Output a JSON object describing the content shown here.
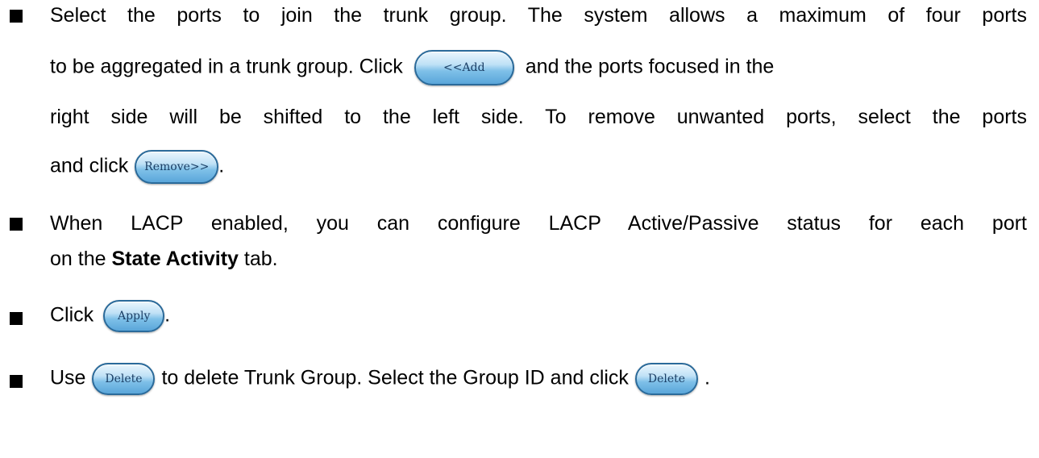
{
  "bullet1": {
    "line1": "Select the ports to join the trunk group. The system allows a maximum of four ports",
    "line2_a": "to be aggregated in a trunk group. Click",
    "add_button": "<<Add",
    "line2_b": "and the ports focused in the",
    "line3": "right side will be shifted to the left side. To remove unwanted ports, select the ports",
    "line4_a": "and click",
    "remove_button": "Remove>>",
    "line4_b": "."
  },
  "bullet2": {
    "line1": "When LACP enabled, you can configure LACP Active/Passive status for each port",
    "line2_a": "on the",
    "line2_bold": "State Activity",
    "line2_b": "tab."
  },
  "bullet3": {
    "text_a": "Click",
    "apply_button": "Apply",
    "text_b": "."
  },
  "bullet4": {
    "text_a": "Use",
    "delete_button_1": "Delete",
    "text_b": "to delete Trunk Group. Select the Group ID and click",
    "delete_button_2": "Delete",
    "text_c": "."
  }
}
